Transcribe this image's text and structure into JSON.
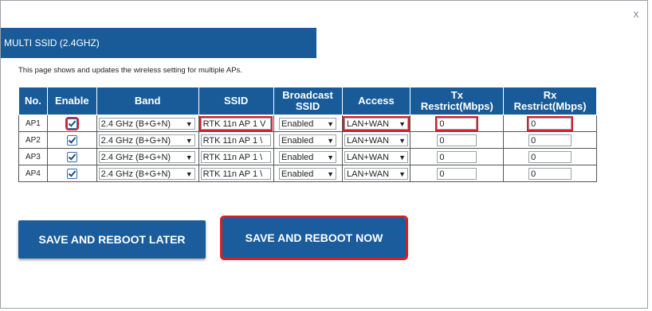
{
  "dialog": {
    "close_label": "x"
  },
  "title": "MULTI SSID (2.4GHZ)",
  "description": "This page shows and updates the wireless setting for multiple APs.",
  "table": {
    "headers": {
      "no": "No.",
      "enable": "Enable",
      "band": "Band",
      "ssid": "SSID",
      "broadcast_line1": "Broadcast",
      "broadcast_line2": "SSID",
      "access": "Access",
      "tx_line1": "Tx",
      "tx_line2": "Restrict(Mbps)",
      "rx_line1": "Rx",
      "rx_line2": "Restrict(Mbps)"
    },
    "rows": [
      {
        "no": "AP1",
        "enabled": true,
        "band": "2.4 GHz (B+G+N)",
        "ssid": "RTK 11n AP 1 V",
        "broadcast": "Enabled",
        "access": "LAN+WAN",
        "tx": "0",
        "rx": "0"
      },
      {
        "no": "AP2",
        "enabled": true,
        "band": "2.4 GHz (B+G+N)",
        "ssid": "RTK 11n AP 1 \\",
        "broadcast": "Enabled",
        "access": "LAN+WAN",
        "tx": "0",
        "rx": "0"
      },
      {
        "no": "AP3",
        "enabled": true,
        "band": "2.4 GHz (B+G+N)",
        "ssid": "RTK 11n AP 1 \\",
        "broadcast": "Enabled",
        "access": "LAN+WAN",
        "tx": "0",
        "rx": "0"
      },
      {
        "no": "AP4",
        "enabled": true,
        "band": "2.4 GHz (B+G+N)",
        "ssid": "RTK 11n AP 1 \\",
        "broadcast": "Enabled",
        "access": "LAN+WAN",
        "tx": "0",
        "rx": "0"
      }
    ]
  },
  "buttons": {
    "save_later": "SAVE AND REBOOT LATER",
    "save_now": "SAVE AND REBOOT NOW"
  },
  "colors": {
    "accent": "#185b98",
    "highlight": "#d62027"
  }
}
